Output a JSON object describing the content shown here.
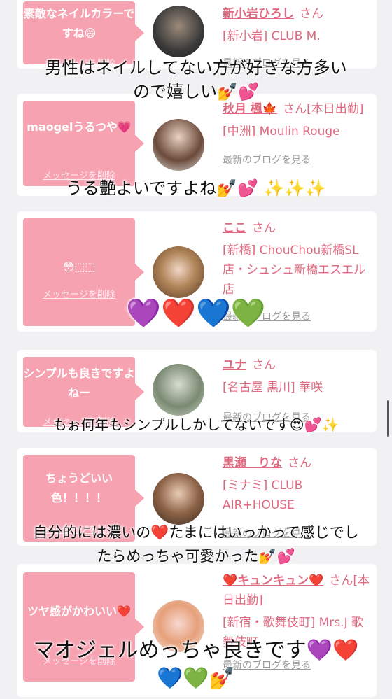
{
  "delete_label": "メッセージを削除",
  "blog_label": "最新のブログを見る",
  "san": "さん",
  "cards": [
    {
      "message": "素敵なネイルカラーですね😄",
      "name": "新小岩ひろし",
      "suffix": "",
      "shop": "[新小岩] CLUB M.",
      "overlay": [
        "男性はネイルしてない方が好きな方多い",
        "ので嬉しい💅💕"
      ]
    },
    {
      "message": "maogelうるつや💗",
      "name": "秋月 楓🍁",
      "suffix": "[本日出勤]",
      "shop": "[中洲] Moulin Rouge",
      "overlay": [
        "うる艶よいですよね💅💕 ✨✨✨"
      ]
    },
    {
      "message": "😳⬚⬚",
      "name": "ここ",
      "suffix": "",
      "shop": "[新橋] ChouChou新橋SL店・シュシュ新橋エスエル店",
      "overlay": [
        "💜❤️💙💚"
      ]
    },
    {
      "message": "シンプルも良きですよねー",
      "name": "ユナ",
      "suffix": "",
      "shop": "[名古屋 黒川] 華咲",
      "overlay": [
        "もぉ何年もシンプルしかしてないです😍💕✨"
      ]
    },
    {
      "message": "ちょうどいい色！！！！",
      "name": "黒瀬　りな",
      "suffix": "",
      "shop": "[ミナミ] CLUB AIR+HOUSE",
      "overlay": [
        "自分的には濃いの❤️たまにはいっかって感じでし",
        "たらめっちゃ可愛かった💅💕"
      ]
    },
    {
      "message": "ツヤ感がかわいい❤️",
      "name": "❤️キュンキュン❤️",
      "suffix": "[本日出勤]",
      "shop": "[新宿・歌舞伎町] Mrs.J 歌舞伎町",
      "overlay": [
        "マオジェルめっちゃ良きです💜❤️",
        "💙💚💅"
      ]
    }
  ]
}
